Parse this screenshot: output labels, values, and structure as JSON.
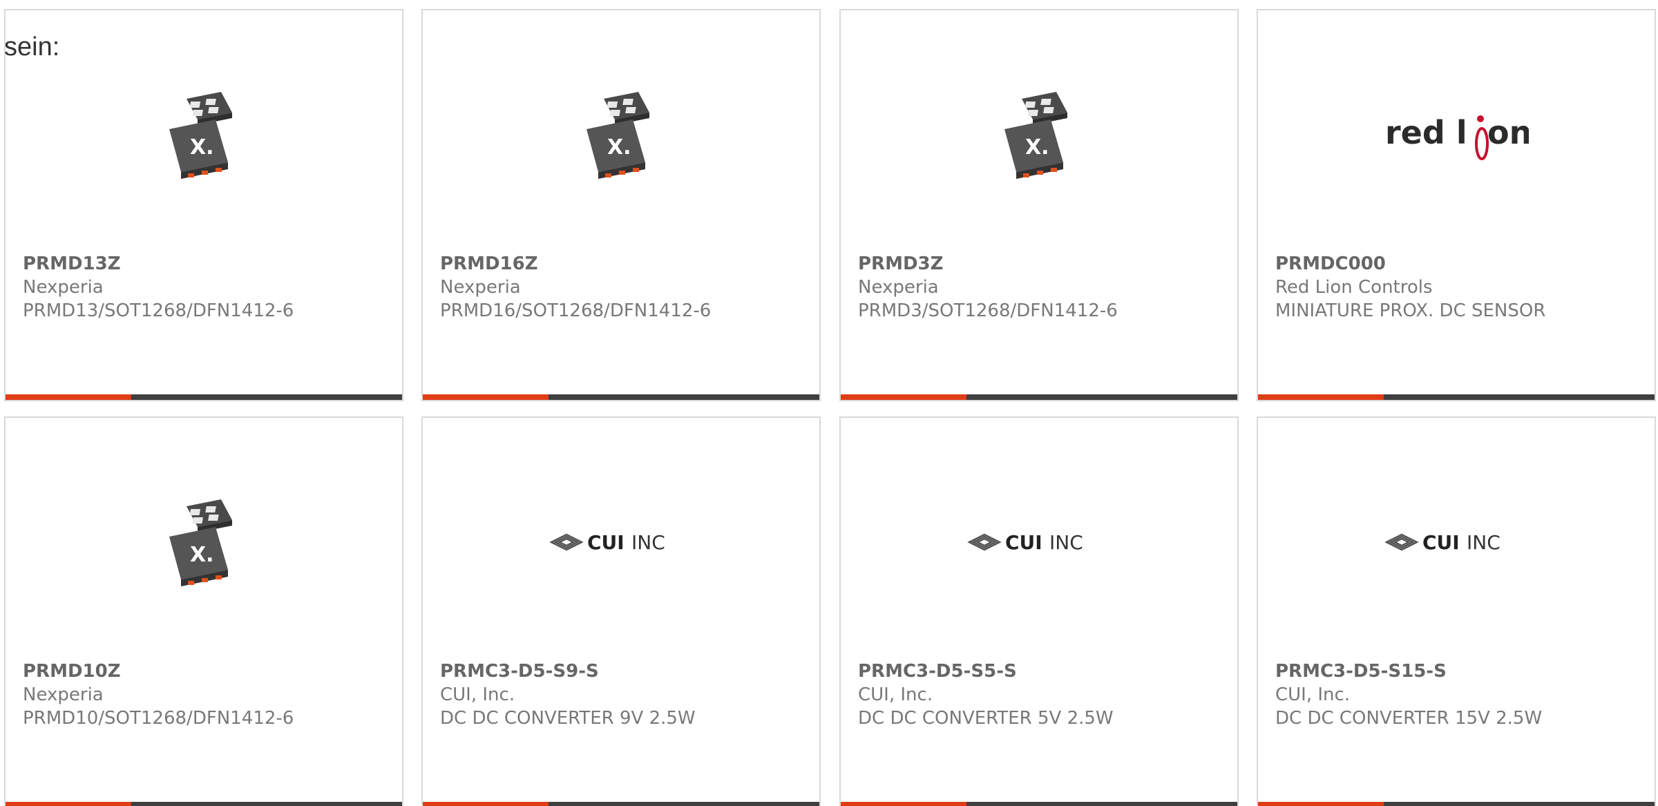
{
  "intro_text": "sein:",
  "colors": {
    "accent": "#e03c16",
    "bar": "#3f3f3f",
    "border": "#d9d9d9",
    "text": "#707070"
  },
  "cards": [
    {
      "part_number": "PRMD13Z",
      "manufacturer": "Nexperia",
      "description": "PRMD13/SOT1268/DFN1412-6",
      "image": "chip-package-icon"
    },
    {
      "part_number": "PRMD16Z",
      "manufacturer": "Nexperia",
      "description": "PRMD16/SOT1268/DFN1412-6",
      "image": "chip-package-icon"
    },
    {
      "part_number": "PRMD3Z",
      "manufacturer": "Nexperia",
      "description": "PRMD3/SOT1268/DFN1412-6",
      "image": "chip-package-icon"
    },
    {
      "part_number": "PRMDC000",
      "manufacturer": "Red Lion Controls",
      "description": "MINIATURE PROX. DC SENSOR",
      "image": "red-lion-logo",
      "logo_text": "red lion"
    },
    {
      "part_number": "PRMD10Z",
      "manufacturer": "Nexperia",
      "description": "PRMD10/SOT1268/DFN1412-6",
      "image": "chip-package-icon"
    },
    {
      "part_number": "PRMC3-D5-S9-S",
      "manufacturer": "CUI, Inc.",
      "description": "DC DC CONVERTER 9V 2.5W",
      "image": "cui-inc-logo",
      "logo_text": "CUI INC"
    },
    {
      "part_number": "PRMC3-D5-S5-S",
      "manufacturer": "CUI, Inc.",
      "description": "DC DC CONVERTER 5V 2.5W",
      "image": "cui-inc-logo",
      "logo_text": "CUI INC"
    },
    {
      "part_number": "PRMC3-D5-S15-S",
      "manufacturer": "CUI, Inc.",
      "description": "DC DC CONVERTER 15V 2.5W",
      "image": "cui-inc-logo",
      "logo_text": "CUI INC"
    }
  ]
}
